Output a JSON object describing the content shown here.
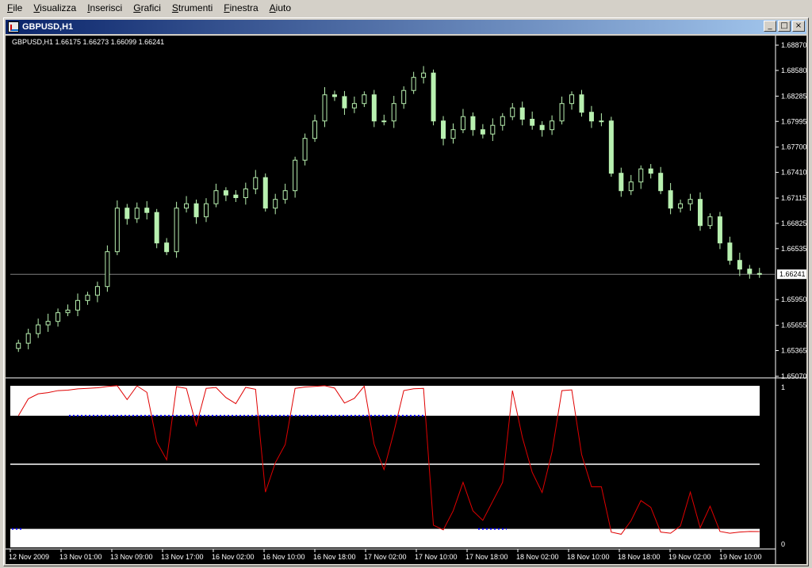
{
  "menubar": {
    "items": [
      "File",
      "Visualizza",
      "Inserisci",
      "Grafici",
      "Strumenti",
      "Finestra",
      "Aiuto"
    ]
  },
  "window": {
    "title": "GBPUSD,H1",
    "minimize_glyph": "_",
    "restore_glyph": "□",
    "close_glyph": "×"
  },
  "chart": {
    "symbol_header": "GBPUSD,H1  1.66175 1.66273 1.66099 1.66241",
    "current_price": "1.66241",
    "price_ticks": [
      "1.68870",
      "1.68580",
      "1.68285",
      "1.67995",
      "1.67700",
      "1.67410",
      "1.67115",
      "1.66825",
      "1.66535",
      "1.66241",
      "1.65950",
      "1.65655",
      "1.65365",
      "1.65070"
    ],
    "indicator_ticks": [
      "1",
      "0"
    ],
    "time_labels": [
      "12 Nov 2009",
      "13 Nov 01:00",
      "13 Nov 09:00",
      "13 Nov 17:00",
      "16 Nov 02:00",
      "16 Nov 10:00",
      "16 Nov 18:00",
      "17 Nov 02:00",
      "17 Nov 10:00",
      "17 Nov 18:00",
      "18 Nov 02:00",
      "18 Nov 10:00",
      "18 Nov 18:00",
      "19 Nov 02:00",
      "19 Nov 10:00"
    ],
    "colors": {
      "background": "#000000",
      "candle": "#b8f0b0",
      "indicator_line": "#e00000",
      "signal_dots": "#0000ff",
      "grid_line": "#808080"
    }
  },
  "chart_data": {
    "type": "candlestick",
    "symbol": "GBPUSD",
    "timeframe": "H1",
    "ohlc_last": {
      "open": 1.66175,
      "high": 1.66273,
      "low": 1.66099,
      "close": 1.66241
    },
    "ylim": [
      1.6507,
      1.6887
    ],
    "closes": [
      1.6545,
      1.6556,
      1.6566,
      1.657,
      1.658,
      1.6583,
      1.6594,
      1.66,
      1.661,
      1.665,
      1.67,
      1.6688,
      1.67,
      1.6695,
      1.666,
      1.665,
      1.67,
      1.6705,
      1.669,
      1.6705,
      1.672,
      1.6715,
      1.6712,
      1.6722,
      1.6735,
      1.67,
      1.671,
      1.672,
      1.6755,
      1.678,
      1.68,
      1.683,
      1.6828,
      1.6815,
      1.682,
      1.683,
      1.68,
      1.68,
      1.682,
      1.6835,
      1.685,
      1.6855,
      1.68,
      1.678,
      1.679,
      1.6805,
      1.679,
      1.6785,
      1.6795,
      1.6805,
      1.6815,
      1.6802,
      1.6795,
      1.679,
      1.68,
      1.682,
      1.683,
      1.681,
      1.68,
      1.68,
      1.674,
      1.672,
      1.673,
      1.6745,
      1.674,
      1.672,
      1.67,
      1.6705,
      1.671,
      1.668,
      1.669,
      1.666,
      1.664,
      1.663,
      1.6625,
      1.6624
    ],
    "indicator": {
      "range": [
        0,
        1
      ],
      "upper_level": 0.8,
      "middle_level": 0.5,
      "lower_level": 0.1
    }
  }
}
